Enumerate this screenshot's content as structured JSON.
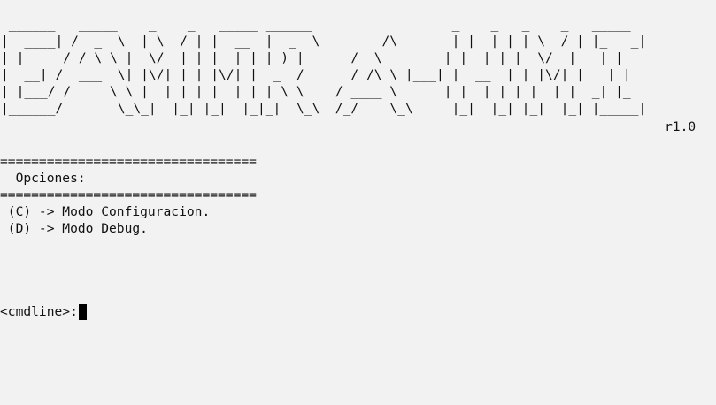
{
  "banner": {
    "ascii_art": " ______   _____    _    _   _____ ______                  _    _   _    _   _____\n|  ____| /  _  \\  | \\  / | |  __  |  _  \\        /\\       | |  | | | \\  / | |_   _|\n| |__   / /_\\ \\ |  \\/  | | |  | | |_) |      /  \\   ___  | |__| | |  \\/  |   | |\n|  __| /  ___  \\| |\\/| | | |\\/| |  _  /      / /\\ \\ |___| |  __  | | |\\/| |   | |\n| |___/ /     \\ \\ |  | | | |  | | | \\ \\    / ____ \\      | |  | | | |  | |  _| |_\n|______/       \\_\\_|  |_| |_|  |_|_|  \\_\\  /_/    \\_\\     |_|  |_| |_|  |_| |_____|",
    "version": "r1.0"
  },
  "menu": {
    "rule": "=================================",
    "title": "  Opciones:",
    "options": [
      " (C) -> Modo Configuracion.",
      " (D) -> Modo Debug."
    ]
  },
  "prompt": {
    "label": "<cmdline>:",
    "value": ""
  }
}
